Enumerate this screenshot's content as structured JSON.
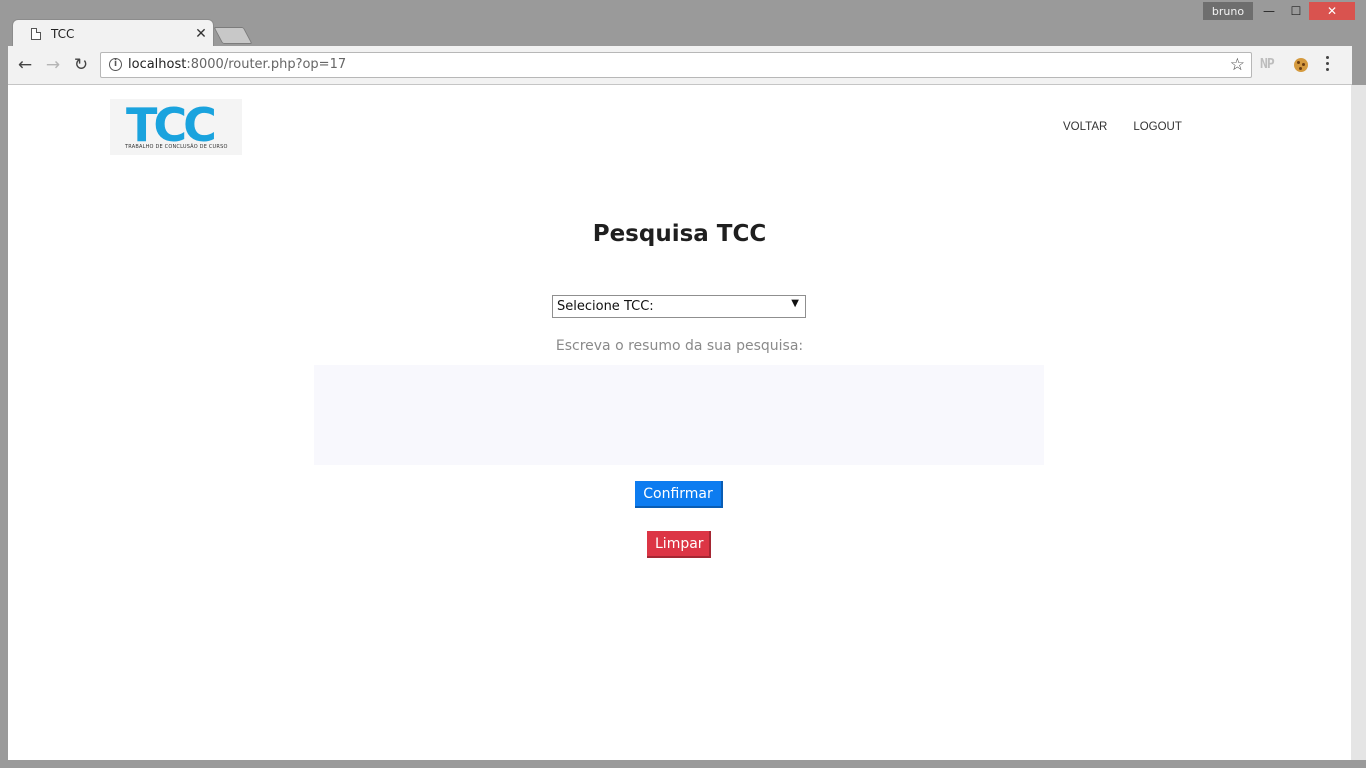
{
  "browser": {
    "tab_title": "TCC",
    "tab_close": "✕",
    "profile_name": "bruno",
    "url_host": "localhost",
    "url_rest": ":8000/router.php?op=17",
    "ext_np": "NP",
    "win_min": "—",
    "win_max": "☐",
    "win_close": "✕"
  },
  "header": {
    "logo_text": "TCC",
    "logo_subtitle": "TRABALHO DE CONCLUSÃO DE CURSO",
    "nav": [
      "VOLTAR",
      "LOGOUT"
    ]
  },
  "main": {
    "title": "Pesquisa TCC",
    "select_value": "Selecione TCC:",
    "prompt": "Escreva o resumo da sua pesquisa:",
    "summary_value": "",
    "confirm_label": "Confirmar",
    "clear_label": "Limpar"
  },
  "colors": {
    "logo_blue": "#1aa3de",
    "confirm_blue": "#0d7cf0",
    "clear_red": "#dc3545"
  }
}
